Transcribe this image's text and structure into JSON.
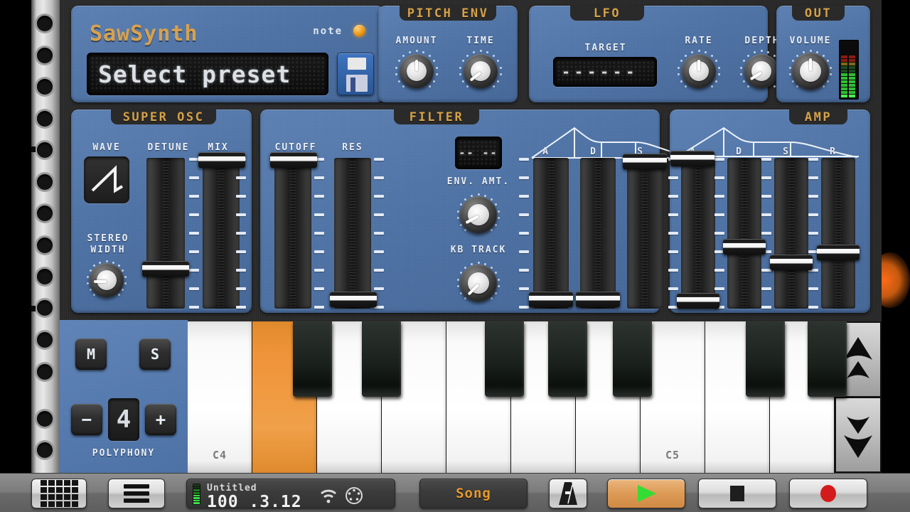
{
  "app": {
    "name": "SawSynth",
    "note_label": "note",
    "note_led_color": "#f0a020"
  },
  "preset": {
    "display_text": "Select preset",
    "save_icon": "floppy-disk-icon"
  },
  "sections": {
    "pitch_env": {
      "title": "PITCH ENV",
      "knobs": [
        {
          "label": "AMOUNT",
          "value": 50,
          "angle": 0
        },
        {
          "label": "TIME",
          "value": 20,
          "angle": -128
        }
      ]
    },
    "lfo": {
      "title": "LFO",
      "target_label": "TARGET",
      "target_value": "------",
      "knobs": [
        {
          "label": "RATE",
          "value": 50,
          "angle": 0
        },
        {
          "label": "DEPTH",
          "value": 22,
          "angle": -122
        }
      ]
    },
    "out": {
      "title": "OUT",
      "volume_label": "VOLUME",
      "volume_value": 50,
      "volume_angle": 0,
      "meter_label": "output-level-meter"
    },
    "super_osc": {
      "title": "SUPER OSC",
      "wave_label": "WAVE",
      "wave_shape": "sawtooth",
      "stereo_label_line1": "STEREO",
      "stereo_label_line2": "WIDTH",
      "stereo_value": 30,
      "stereo_angle": -90,
      "sliders": [
        {
          "label": "DETUNE",
          "value": 34
        },
        {
          "label": "MIX",
          "value": 96
        }
      ]
    },
    "filter": {
      "title": "FILTER",
      "type_display": "-- --",
      "env_amt_label": "ENV. AMT.",
      "env_amt_value": 25,
      "env_amt_angle": -118,
      "kb_track_label": "KB TRACK",
      "kb_track_value": 18,
      "kb_track_angle": -135,
      "sliders": [
        {
          "label": "CUTOFF",
          "value": 96
        },
        {
          "label": "RES",
          "value": 3
        }
      ],
      "adsr_labels": [
        "A",
        "D",
        "S",
        "R"
      ],
      "adsr_values": [
        3,
        3,
        92,
        95
      ]
    },
    "amp": {
      "title": "AMP",
      "adsr_labels": [
        "A",
        "D",
        "S",
        "R"
      ],
      "adsr_values": [
        2,
        38,
        30,
        42
      ]
    }
  },
  "voice": {
    "mute_label": "M",
    "solo_label": "S",
    "minus_label": "−",
    "plus_label": "+",
    "polyphony_value": "4",
    "polyphony_label": "POLYPHONY"
  },
  "keyboard": {
    "labels": {
      "c4": "C4",
      "c5": "C5"
    },
    "active_key": "D4",
    "octave_up_icon": "double-chevron-up-icon",
    "octave_down_icon": "double-chevron-down-icon"
  },
  "toolbar": {
    "grid_button": "grid-icon",
    "menu_button": "hamburger-menu-icon",
    "status": {
      "song_name": "Untitled",
      "tempo_position": "100 .3.12",
      "wifi_icon": "wifi-icon",
      "midi_icon": "midi-din-icon"
    },
    "mode_label": "Song",
    "metronome_icon": "metronome-icon",
    "play_icon": "play-triangle-icon",
    "stop_icon": "stop-square-icon",
    "record_icon": "record-circle-icon",
    "play_color": "#e0a263",
    "record_color": "#d41b1b",
    "play_triangle_color": "#33dd33"
  }
}
